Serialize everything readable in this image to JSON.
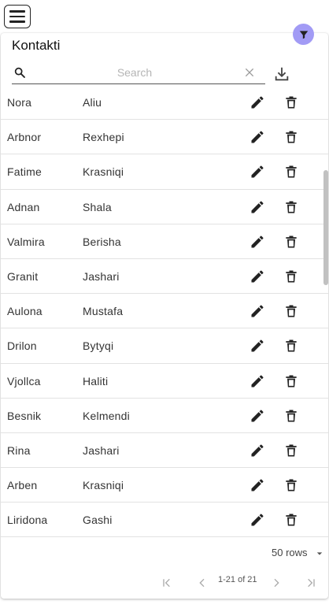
{
  "app": {
    "title": "Kontakti"
  },
  "toolbar": {
    "search_placeholder": "Search",
    "search_value": ""
  },
  "contacts": [
    {
      "first": "Nora",
      "last": "Aliu"
    },
    {
      "first": "Arbnor",
      "last": "Rexhepi"
    },
    {
      "first": "Fatime",
      "last": "Krasniqi"
    },
    {
      "first": "Adnan",
      "last": "Shala"
    },
    {
      "first": "Valmira",
      "last": "Berisha"
    },
    {
      "first": "Granit",
      "last": "Jashari"
    },
    {
      "first": "Aulona",
      "last": "Mustafa"
    },
    {
      "first": "Drilon",
      "last": "Bytyqi"
    },
    {
      "first": "Vjollca",
      "last": "Haliti"
    },
    {
      "first": "Besnik",
      "last": "Kelmendi"
    },
    {
      "first": "Rina",
      "last": "Jashari"
    },
    {
      "first": "Arben",
      "last": "Krasniqi"
    },
    {
      "first": "Liridona",
      "last": "Gashi"
    }
  ],
  "pagination": {
    "rows_per_page": "50 rows",
    "range": "1-21 of 21"
  },
  "icons": {
    "menu": "hamburger-icon",
    "filter": "filter-icon",
    "search": "search-icon",
    "clear": "close-icon",
    "download": "download-icon",
    "edit": "pencil-icon",
    "delete": "trash-icon"
  },
  "colors": {
    "filter_button": "#a29bf5"
  }
}
